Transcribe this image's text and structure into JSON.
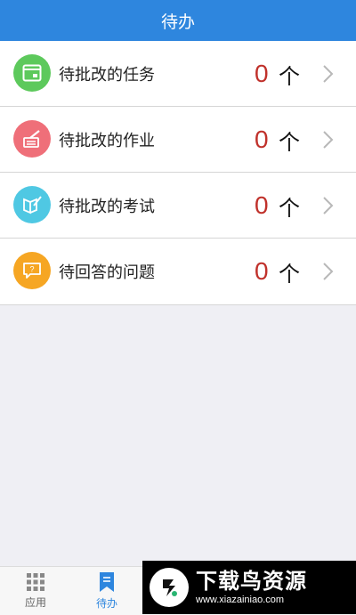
{
  "header": {
    "title": "待办"
  },
  "items": [
    {
      "label": "待批改的任务",
      "count": "0",
      "unit": "个",
      "icon": "task-icon",
      "color": "#5dc95c"
    },
    {
      "label": "待批改的作业",
      "count": "0",
      "unit": "个",
      "icon": "homework-icon",
      "color": "#ef6f79"
    },
    {
      "label": "待批改的考试",
      "count": "0",
      "unit": "个",
      "icon": "exam-icon",
      "color": "#4fc8e3"
    },
    {
      "label": "待回答的问题",
      "count": "0",
      "unit": "个",
      "icon": "question-icon",
      "color": "#f6a623"
    }
  ],
  "tabbar": {
    "apps_label": "应用",
    "todo_label": "待办",
    "active": "待办"
  },
  "watermark": {
    "title": "下载鸟资源",
    "url": "www.xiazainiao.com"
  }
}
